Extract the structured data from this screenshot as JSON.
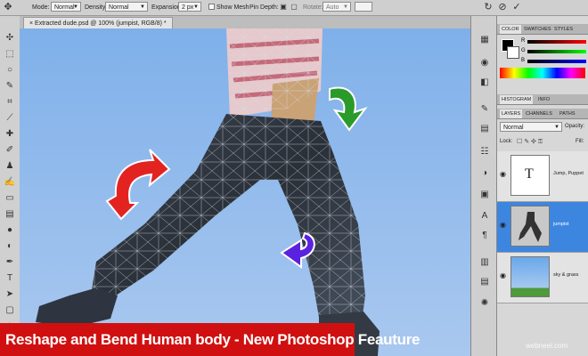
{
  "options_bar": {
    "mode_label": "Mode:",
    "mode_value": "Normal",
    "density_label": "Density:",
    "density_value": "Normal",
    "expansion_label": "Expansion:",
    "expansion_value": "2 px",
    "show_mesh_label": "Show Mesh",
    "pin_depth_label": "Pin Depth:",
    "rotate_label": "Rotate:",
    "rotate_value": "Auto"
  },
  "document": {
    "tab_title": "Extracted dude.psd @ 100% (jumpist, RGB/8) *"
  },
  "color_panel": {
    "tabs": [
      "COLOR",
      "SWATCHES",
      "STYLES"
    ],
    "channels": [
      "R",
      "G",
      "B"
    ]
  },
  "histogram_panel": {
    "tabs": [
      "HISTOGRAM",
      "INFO"
    ]
  },
  "layers_panel": {
    "tabs": [
      "LAYERS",
      "CHANNELS",
      "PATHS"
    ],
    "blend_mode": "Normal",
    "opacity_label": "Opacity:",
    "lock_label": "Lock:",
    "fill_label": "Fill:",
    "layers": [
      {
        "name": "Jump, Puppet",
        "thumb_text": "T"
      },
      {
        "name": "jumpist"
      },
      {
        "name": "sky & grass"
      }
    ]
  },
  "banner": {
    "text": "Reshape and Bend Human body - New Photoshop Feauture"
  },
  "watermark": "webneel.com",
  "colors": {
    "banner": "#d01010",
    "active_layer": "#3d86e0",
    "arrow_red": "#e3231f",
    "arrow_green": "#2a9a2a",
    "arrow_purple": "#5a22e0"
  }
}
